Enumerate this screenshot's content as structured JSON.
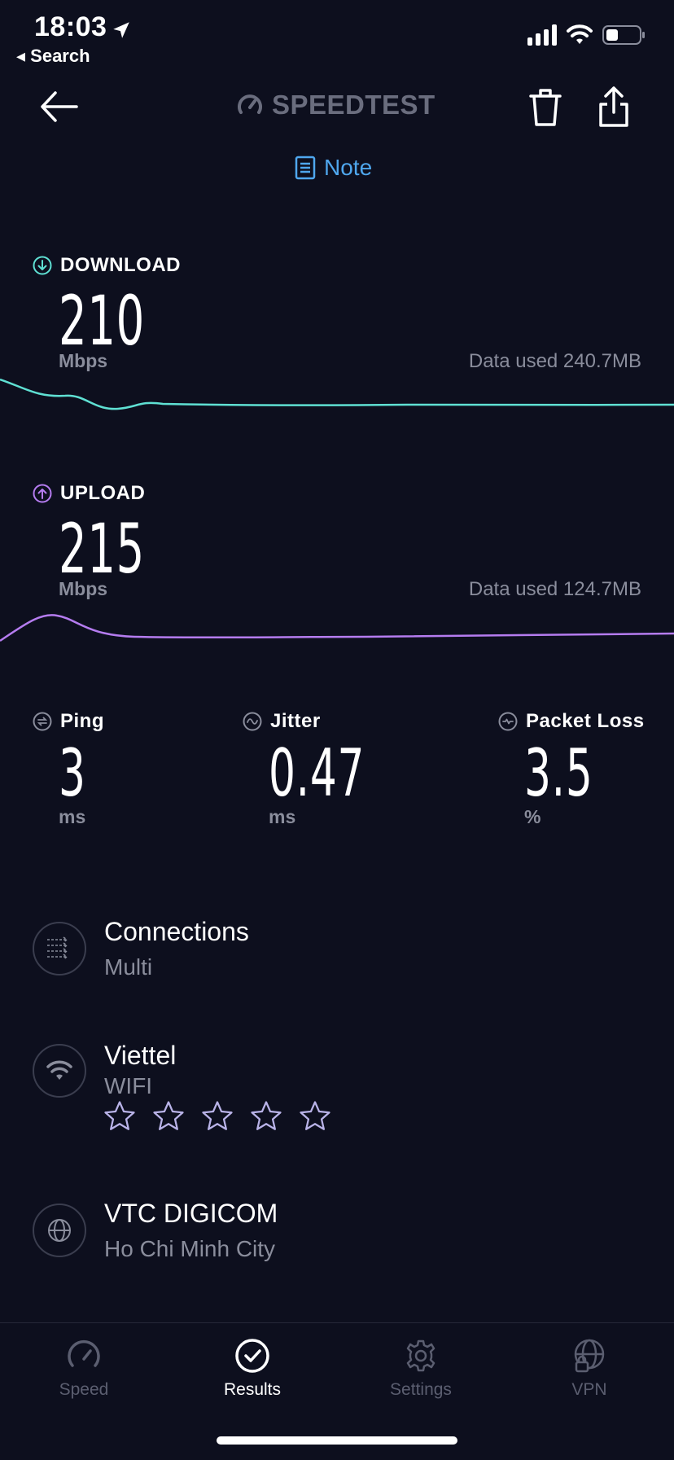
{
  "status_bar": {
    "time": "18:03",
    "back_label": "◂ Search",
    "icons": [
      "location-arrow-icon",
      "signal-icon",
      "wifi-icon",
      "battery-icon"
    ]
  },
  "header": {
    "logo_text": "SPEEDTEST",
    "note_label": "Note",
    "icons": [
      "back-arrow-icon",
      "speedtest-gauge-icon",
      "trash-icon",
      "share-icon",
      "note-icon"
    ]
  },
  "download": {
    "label": "DOWNLOAD",
    "value": "210",
    "unit": "Mbps",
    "data_used": "Data used 240.7MB",
    "color": "#5fe0d3"
  },
  "upload": {
    "label": "UPLOAD",
    "value": "215",
    "unit": "Mbps",
    "data_used": "Data used 124.7MB",
    "color": "#b57cf0"
  },
  "stats": {
    "ping": {
      "label": "Ping",
      "value": "3",
      "unit": "ms"
    },
    "jitter": {
      "label": "Jitter",
      "value": "0.47",
      "unit": "ms"
    },
    "packet_loss": {
      "label": "Packet Loss",
      "value": "3.5",
      "unit": "%"
    }
  },
  "connections": {
    "title": "Connections",
    "subtitle": "Multi"
  },
  "network": {
    "title": "Viettel",
    "subtitle": "WIFI",
    "rating_stars": 5,
    "rating_filled": 0
  },
  "provider": {
    "title": "VTC DIGICOM",
    "subtitle": "Ho Chi Minh City"
  },
  "tabs": [
    {
      "label": "Speed",
      "icon": "gauge-icon"
    },
    {
      "label": "Results",
      "icon": "check-circle-icon"
    },
    {
      "label": "Settings",
      "icon": "gear-icon"
    },
    {
      "label": "VPN",
      "icon": "globe-lock-icon"
    }
  ],
  "active_tab": "Results",
  "colors": {
    "background": "#0d0f1e",
    "accent_blue": "#4fa7ee",
    "muted_text": "#8a8d9c"
  }
}
